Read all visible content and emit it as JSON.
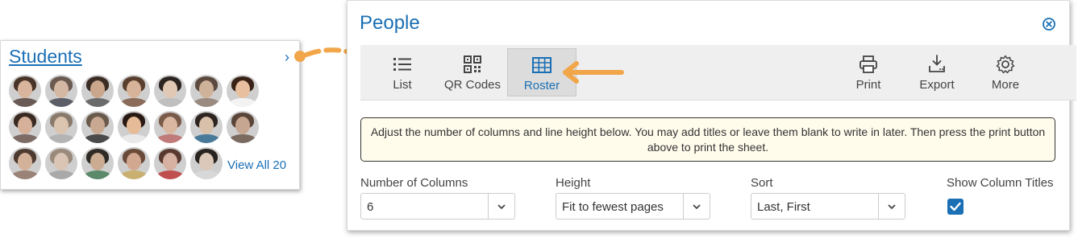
{
  "students": {
    "title": "Students",
    "chevron": "›",
    "view_all": "View All 20",
    "avatars": [
      {
        "skin": "#d8b59c",
        "hair": "#4a3428",
        "shirt": "#6a5a55"
      },
      {
        "skin": "#d4b8a4",
        "hair": "#6a5a50",
        "shirt": "#5b5e66"
      },
      {
        "skin": "#c9a68c",
        "hair": "#3b2c24",
        "shirt": "#6b6b6b"
      },
      {
        "skin": "#d7b39a",
        "hair": "#5a3f2e",
        "shirt": "#8b6b5a"
      },
      {
        "skin": "#e0c8b4",
        "hair": "#2c2420",
        "shirt": "#bfbfbf"
      },
      {
        "skin": "#cfb29a",
        "hair": "#5d4a3e",
        "shirt": "#9a8a80"
      },
      {
        "skin": "#e8c0a0",
        "hair": "#3a2216",
        "shirt": "#f3f3f3"
      },
      {
        "skin": "#d6b098",
        "hair": "#3a2a22",
        "shirt": "#7d6b66"
      },
      {
        "skin": "#dbc4b0",
        "hair": "#8a7a6c",
        "shirt": "#b4b4b4"
      },
      {
        "skin": "#c8a890",
        "hair": "#6a5a4c",
        "shirt": "#4a4a4a"
      },
      {
        "skin": "#e6bc98",
        "hair": "#2a1a14",
        "shirt": "#e9e9e9"
      },
      {
        "skin": "#d9b7a0",
        "hair": "#7a5a48",
        "shirt": "#c07a7a"
      },
      {
        "skin": "#d8c0aa",
        "hair": "#2e2420",
        "shirt": "#4a7a9a"
      },
      {
        "skin": "#c6a690",
        "hair": "#5a4538",
        "shirt": "#7a6a60"
      },
      {
        "skin": "#d4b29a",
        "hair": "#4e3a30",
        "shirt": "#9a8276"
      },
      {
        "skin": "#dac4b4",
        "hair": "#9a8a7a",
        "shirt": "#a9a9a9"
      },
      {
        "skin": "#cbab92",
        "hair": "#2e2a26",
        "shirt": "#5a8a6a"
      },
      {
        "skin": "#d2a890",
        "hair": "#6a4a38",
        "shirt": "#c9b070"
      },
      {
        "skin": "#d6b0a0",
        "hair": "#5a3a30",
        "shirt": "#c05050"
      },
      {
        "skin": "#dcc8b8",
        "hair": "#2a2420",
        "shirt": "#d8d8d8"
      }
    ]
  },
  "panel": {
    "title": "People",
    "close_icon": "close-circle-icon",
    "toolbar": {
      "list": "List",
      "qr": "QR Codes",
      "roster": "Roster",
      "print": "Print",
      "export": "Export",
      "more": "More"
    },
    "info": "Adjust the number of columns and line height below. You may add titles or leave them blank to write in later. Then press the print button above to print the sheet.",
    "fields": {
      "columns_label": "Number of Columns",
      "columns_value": "6",
      "height_label": "Height",
      "height_value": "Fit to fewest pages",
      "sort_label": "Sort",
      "sort_value": "Last, First",
      "titles_label": "Show Column Titles"
    }
  },
  "colors": {
    "accent": "#1a6fb5",
    "arrow": "#f2a64a",
    "info_bg": "#fffcec"
  }
}
